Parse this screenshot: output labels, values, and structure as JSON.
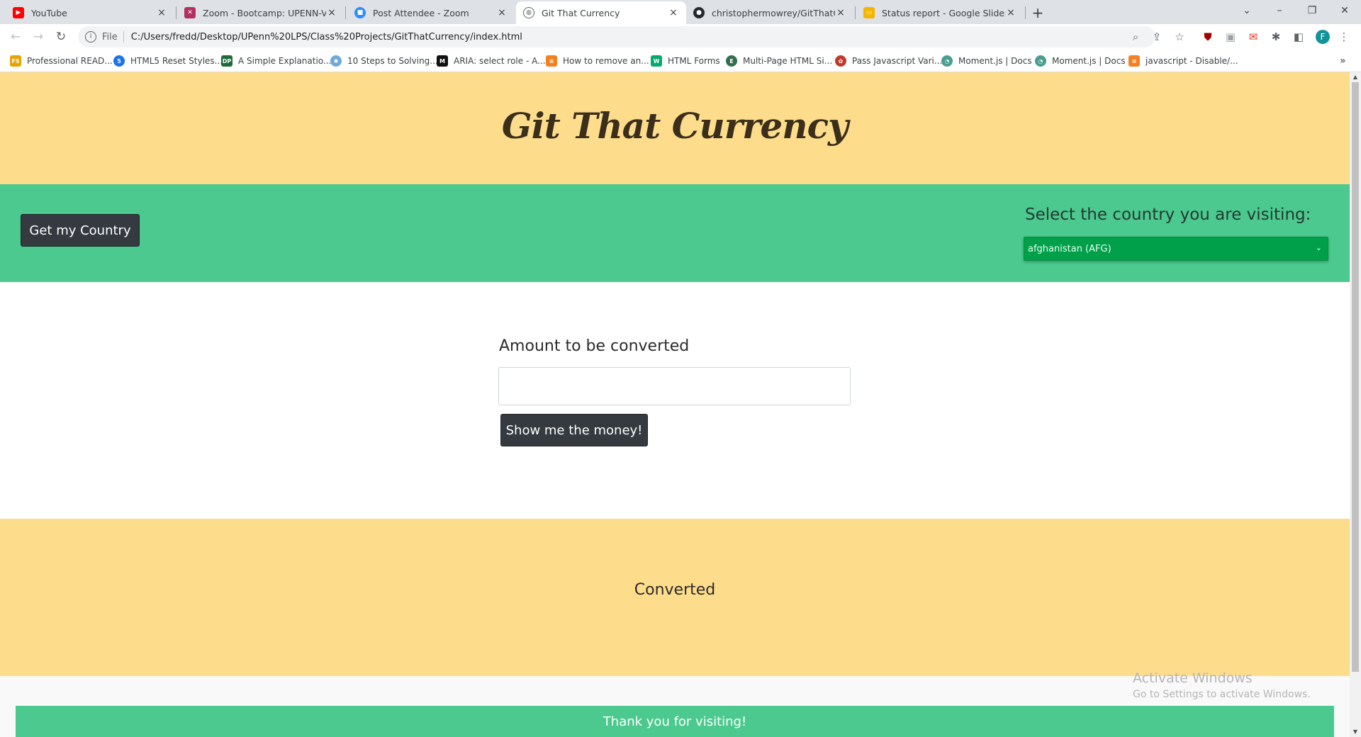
{
  "browser": {
    "tabs": [
      {
        "title": "YouTube",
        "icon": "youtube-icon",
        "color": "#ff0000"
      },
      {
        "title": "Zoom - Bootcamp: UPENN-VIRT-",
        "icon": "bootcamp-icon",
        "color": "#b03060"
      },
      {
        "title": "Post Attendee - Zoom",
        "icon": "zoom-icon",
        "color": "#2d8cff"
      },
      {
        "title": "Git That Currency",
        "icon": "globe-icon",
        "color": "#5f6368",
        "active": true
      },
      {
        "title": "christophermowrey/GitThatCurre",
        "icon": "github-icon",
        "color": "#24292e"
      },
      {
        "title": "Status report - Google Slides",
        "icon": "slides-icon",
        "color": "#f4b400"
      }
    ],
    "close_glyph": "×",
    "new_tab_glyph": "+",
    "address": {
      "scheme_label": "File",
      "url": "C:/Users/fredd/Desktop/UPenn%20LPS/Class%20Projects/GitThatCurrency/index.html"
    },
    "profile_initial": "F",
    "bookmarks": [
      {
        "label": "Professional READ...",
        "icon": "bookmark-fs-icon",
        "color": "#e8a300"
      },
      {
        "label": "HTML5 Reset Styles...",
        "icon": "bookmark-html5-icon",
        "color": "#1a73e8"
      },
      {
        "label": "A Simple Explanatio...",
        "icon": "bookmark-dp-icon",
        "color": "#1e6b3a"
      },
      {
        "label": "10 Steps to Solving...",
        "icon": "bookmark-steps-icon",
        "color": "#6fa8dc"
      },
      {
        "label": "ARIA: select role - A...",
        "icon": "bookmark-mdn-icon",
        "color": "#111111"
      },
      {
        "label": "How to remove an...",
        "icon": "bookmark-so-icon",
        "color": "#f48024"
      },
      {
        "label": "HTML Forms",
        "icon": "bookmark-w3-icon",
        "color": "#04aa6d"
      },
      {
        "label": "Multi-Page HTML Si...",
        "icon": "bookmark-e-icon",
        "color": "#2f6f4f"
      },
      {
        "label": "Pass Javascript Vari...",
        "icon": "bookmark-red-icon",
        "color": "#c0392b"
      },
      {
        "label": "Moment.js | Docs",
        "icon": "bookmark-moment-icon",
        "color": "#4a9d8f"
      },
      {
        "label": "Moment.js | Docs",
        "icon": "bookmark-moment-icon",
        "color": "#4a9d8f"
      },
      {
        "label": "javascript - Disable/...",
        "icon": "bookmark-so-icon",
        "color": "#f48024"
      }
    ]
  },
  "page": {
    "site_title": "Git That Currency",
    "get_country_button": "Get my Country",
    "select_label": "Select the country you are visiting:",
    "country_selected": "afghanistan (AFG)",
    "amount_label": "Amount to be converted",
    "amount_value": "",
    "show_money_button": "Show me the money!",
    "converted_label": "Converted",
    "footer_text": "Thank you for visiting!"
  },
  "os": {
    "watermark_title": "Activate Windows",
    "watermark_subtitle": "Go to Settings to activate Windows."
  },
  "colors": {
    "header_yellow": "#fddc8c",
    "accent_green": "#4bc98e",
    "select_green": "#00a04a",
    "button_dark": "#343a40"
  }
}
